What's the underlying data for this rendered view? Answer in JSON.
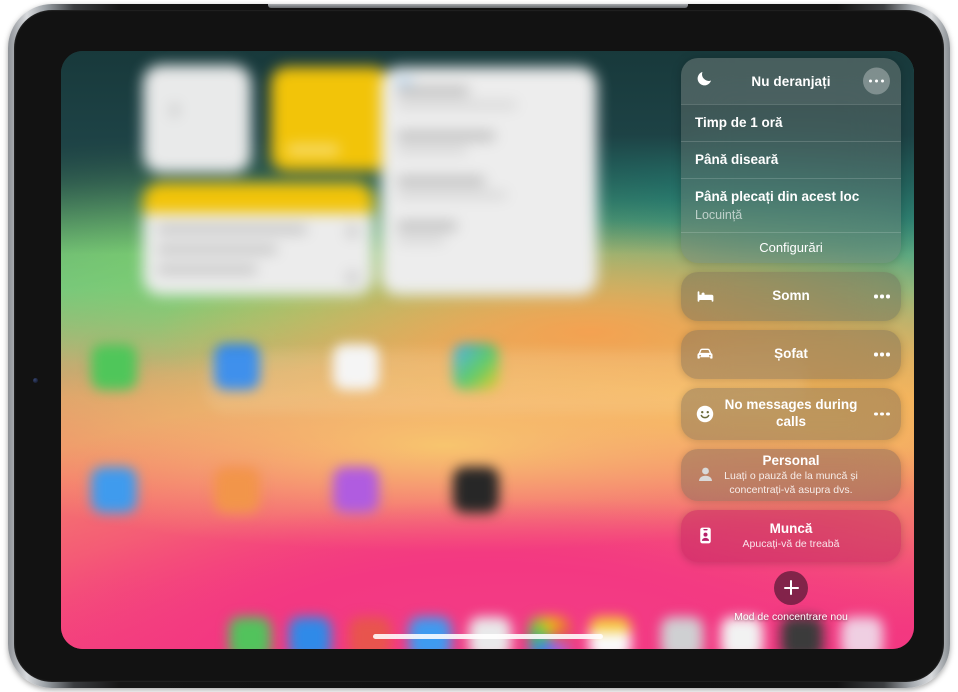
{
  "device": {
    "kind": "ipad",
    "orientation": "landscape"
  },
  "focus_panel": {
    "dnd": {
      "icon": "moon-icon",
      "title": "Nu deranjați",
      "more_icon": "ellipsis-icon",
      "options": [
        {
          "primary": "Timp de 1 oră",
          "secondary": ""
        },
        {
          "primary": "Până diseară",
          "secondary": ""
        },
        {
          "primary": "Până plecați din acest loc",
          "secondary": "Locuință"
        }
      ],
      "settings_label": "Configurări"
    },
    "modes": [
      {
        "icon": "bed-icon",
        "label": "Somn",
        "sub": "",
        "selected": false,
        "more_icon": "ellipsis-icon"
      },
      {
        "icon": "car-icon",
        "label": "Șofat",
        "sub": "",
        "selected": false,
        "more_icon": "ellipsis-icon"
      },
      {
        "icon": "smiley-icon",
        "label": "No messages during calls",
        "sub": "",
        "selected": false,
        "more_icon": "ellipsis-icon"
      },
      {
        "icon": "person-icon",
        "label": "Personal",
        "sub": "Luați o pauză de la muncă și concentrați-vă asupra dvs.",
        "selected": false,
        "more_icon": ""
      },
      {
        "icon": "badge-icon",
        "label": "Muncă",
        "sub": "Apucați-vă de treabă",
        "selected": true,
        "more_icon": ""
      }
    ],
    "new_focus": {
      "icon": "plus-icon",
      "label": "Mod de concentrare nou"
    }
  },
  "colors": {
    "panel_text": "#ffffff",
    "panel_subtext": "rgba(255,255,255,0.62)",
    "wallpaper_pink": "#f3347f",
    "wallpaper_teal": "#1d3b3c",
    "wallpaper_yellow": "#f6c45c",
    "wallpaper_green": "#8fd47c"
  },
  "home_screen": {
    "widgets": [
      {
        "name": "clock-widget"
      },
      {
        "name": "notes-widget"
      },
      {
        "name": "reminders-widget"
      },
      {
        "name": "mail-widget"
      }
    ],
    "app_icons": [
      {
        "name": "app-icon-green"
      },
      {
        "name": "app-icon-blue"
      },
      {
        "name": "app-icon-white"
      },
      {
        "name": "app-icon-multicolor"
      },
      {
        "name": "app-icon-lightblue"
      },
      {
        "name": "app-icon-orange"
      },
      {
        "name": "app-icon-purple"
      },
      {
        "name": "app-icon-dark"
      }
    ],
    "dock_icons": [
      {
        "name": "dock-icon-green"
      },
      {
        "name": "dock-icon-blue"
      },
      {
        "name": "dock-icon-red"
      },
      {
        "name": "dock-icon-skyblue"
      },
      {
        "name": "dock-icon-grey"
      },
      {
        "name": "dock-icon-photos"
      },
      {
        "name": "dock-icon-yellow"
      },
      {
        "name": "dock-icon-silver"
      },
      {
        "name": "dock-icon-white"
      },
      {
        "name": "dock-icon-dark"
      },
      {
        "name": "dock-icon-pale"
      }
    ],
    "home_indicator": "home-indicator"
  }
}
